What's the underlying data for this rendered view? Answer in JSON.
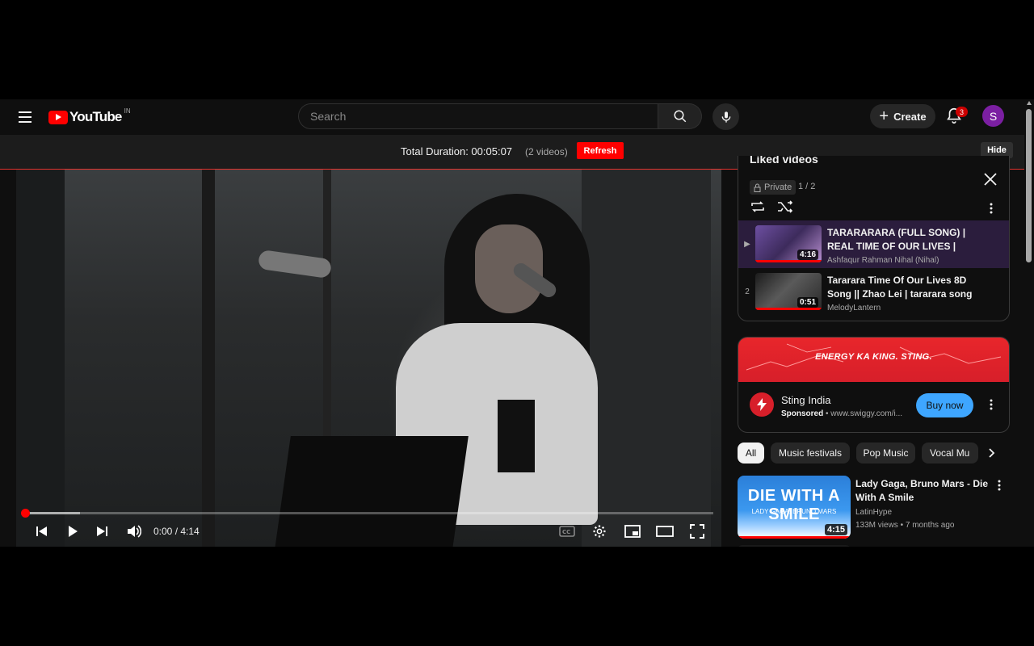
{
  "masthead": {
    "logo_text": "YouTube",
    "country_code": "IN",
    "search_placeholder": "Search",
    "create_label": "Create",
    "notification_count": "3",
    "avatar_letter": "S"
  },
  "duration_bar": {
    "label": "Total Duration: 00:05:07",
    "count": "(2 videos)",
    "refresh_label": "Refresh",
    "hide_label": "Hide"
  },
  "player": {
    "time": "0:00 / 4:14",
    "progress_played": 0.0,
    "progress_loaded": 0.08
  },
  "playlist": {
    "title": "Liked videos",
    "privacy": "Private",
    "position": "1 / 2",
    "items": [
      {
        "index": "▶",
        "title": "TARARARARA (FULL SONG) | REAL TIME OF OUR LIVES | GAO...",
        "channel": "Ashfaqur Rahman Nihal (Nihal)",
        "duration": "4:16",
        "active": true
      },
      {
        "index": "2",
        "title": "Tararara Time Of Our Lives 8D Song || Zhao Lei | tararara song |...",
        "channel": "MelodyLantern",
        "duration": "0:51",
        "active": false
      }
    ]
  },
  "ad": {
    "banner_text": "ENERGY KA KING. STING.",
    "name": "Sting India",
    "sponsored": "Sponsored",
    "url": "www.swiggy.com/i...",
    "cta": "Buy now"
  },
  "chips": [
    "All",
    "Music festivals",
    "Pop Music",
    "Vocal Mu"
  ],
  "recommendation": {
    "thumb_title": "DIE WITH A SMILE",
    "thumb_sub": "LADY GAGA, BRUNO MARS",
    "duration": "4:15",
    "title": "Lady Gaga, Bruno Mars - Die With A Smile",
    "channel": "LatinHype",
    "views": "133M views",
    "age": "7 months ago"
  },
  "colors": {
    "accent": "#ff0000",
    "background": "#0f0f0f",
    "active_item": "#2b1d3d",
    "buy_button": "#3ea6ff"
  }
}
